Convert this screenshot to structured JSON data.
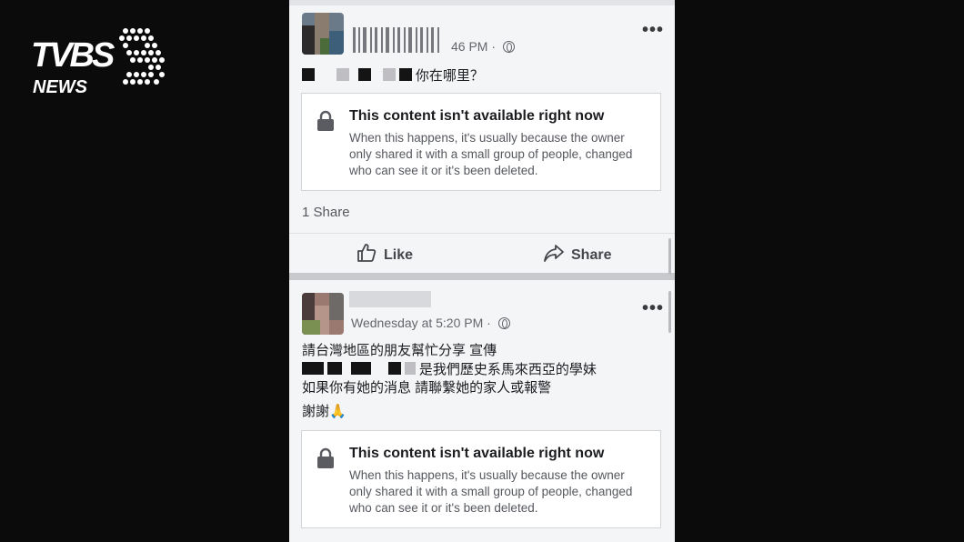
{
  "logo": {
    "brand": "TVBS",
    "sub": "NEWS"
  },
  "post1": {
    "time_suffix": "46 PM",
    "separator": "·",
    "text_suffix": "你在哪里？",
    "unavailable_title": "This content isn't available right now",
    "unavailable_desc": "When this happens, it's usually because the owner only shared it with a small group of people, changed who can see it or it's been deleted.",
    "shares": "1 Share",
    "like_label": "Like",
    "share_label": "Share",
    "more": "•••"
  },
  "post2": {
    "time": "Wednesday at 5:20 PM",
    "separator": "·",
    "line1": "請台灣地區的朋友幫忙分享 宣傳",
    "line2_suffix": "是我們歷史系馬來西亞的學妹",
    "line3": "如果你有她的消息 請聯繫她的家人或報警",
    "line4": "謝謝",
    "line4_emoji": "🙏",
    "unavailable_title": "This content isn't available right now",
    "unavailable_desc": "When this happens, it's usually because the owner only shared it with a small group of people, changed who can see it or it's been deleted.",
    "more": "•••"
  },
  "colors": {
    "background": "#0b0b0b",
    "feed_bg": "#f4f5f7",
    "card_border": "#d2d4d8"
  },
  "icons": [
    "lock-icon",
    "like-icon",
    "share-icon",
    "globe-icon",
    "more-icon"
  ]
}
